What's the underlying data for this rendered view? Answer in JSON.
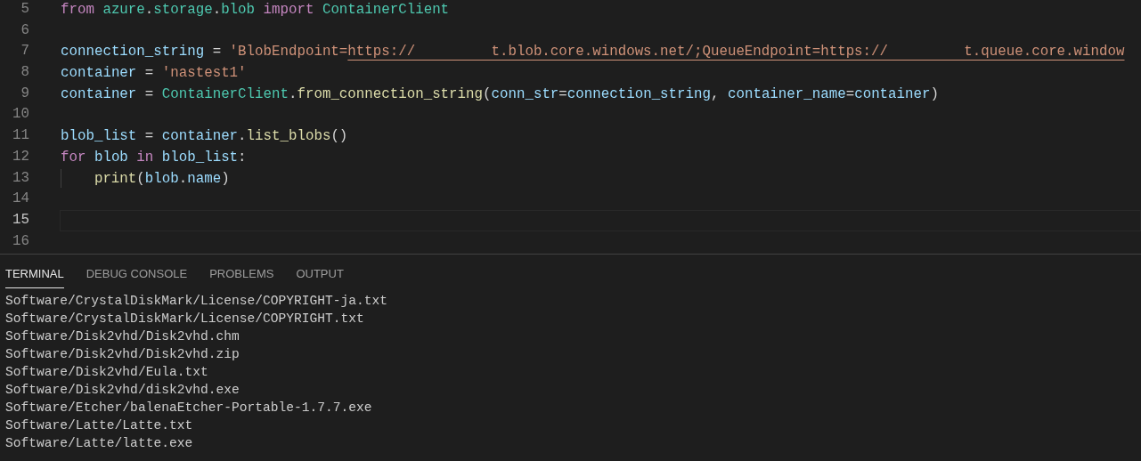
{
  "editor": {
    "lines": [
      {
        "number": "5",
        "current": false,
        "indented": false,
        "tokens": [
          {
            "text": "from ",
            "kind": "keyword"
          },
          {
            "text": "azure",
            "kind": "namespace"
          },
          {
            "text": ".",
            "kind": "plain"
          },
          {
            "text": "storage",
            "kind": "namespace"
          },
          {
            "text": ".",
            "kind": "plain"
          },
          {
            "text": "blob ",
            "kind": "namespace"
          },
          {
            "text": "import ",
            "kind": "keyword"
          },
          {
            "text": "ContainerClient",
            "kind": "namespace"
          }
        ]
      },
      {
        "number": "6",
        "current": false,
        "indented": false
      },
      {
        "number": "7",
        "current": false,
        "indented": false,
        "tokens": [
          {
            "text": "connection_string",
            "kind": "variable"
          },
          {
            "text": " = ",
            "kind": "plain"
          },
          {
            "text": "'BlobEndpoint=",
            "kind": "string"
          },
          {
            "text": "https://         t.blob.core.windows.net/;QueueEndpoint=https://         t.queue.core.window",
            "kind": "link"
          }
        ]
      },
      {
        "number": "8",
        "current": false,
        "indented": false,
        "tokens": [
          {
            "text": "container",
            "kind": "variable"
          },
          {
            "text": " = ",
            "kind": "plain"
          },
          {
            "text": "'nastest1'",
            "kind": "string"
          }
        ]
      },
      {
        "number": "9",
        "current": false,
        "indented": false,
        "tokens": [
          {
            "text": "container",
            "kind": "variable"
          },
          {
            "text": " = ",
            "kind": "plain"
          },
          {
            "text": "ContainerClient",
            "kind": "namespace"
          },
          {
            "text": ".",
            "kind": "plain"
          },
          {
            "text": "from_connection_string",
            "kind": "function"
          },
          {
            "text": "(",
            "kind": "plain"
          },
          {
            "text": "conn_str",
            "kind": "variable"
          },
          {
            "text": "=",
            "kind": "plain"
          },
          {
            "text": "connection_string",
            "kind": "variable"
          },
          {
            "text": ", ",
            "kind": "plain"
          },
          {
            "text": "container_name",
            "kind": "variable"
          },
          {
            "text": "=",
            "kind": "plain"
          },
          {
            "text": "container",
            "kind": "variable"
          },
          {
            "text": ")",
            "kind": "plain"
          }
        ]
      },
      {
        "number": "10",
        "current": false,
        "indented": false
      },
      {
        "number": "11",
        "current": false,
        "indented": false,
        "tokens": [
          {
            "text": "blob_list",
            "kind": "variable"
          },
          {
            "text": " = ",
            "kind": "plain"
          },
          {
            "text": "container",
            "kind": "variable"
          },
          {
            "text": ".",
            "kind": "plain"
          },
          {
            "text": "list_blobs",
            "kind": "function"
          },
          {
            "text": "()",
            "kind": "plain"
          }
        ]
      },
      {
        "number": "12",
        "current": false,
        "indented": false,
        "tokens": [
          {
            "text": "for ",
            "kind": "keyword"
          },
          {
            "text": "blob ",
            "kind": "variable"
          },
          {
            "text": "in ",
            "kind": "keyword"
          },
          {
            "text": "blob_list",
            "kind": "variable"
          },
          {
            "text": ":",
            "kind": "plain"
          }
        ]
      },
      {
        "number": "13",
        "current": false,
        "indented": true,
        "tokens": [
          {
            "text": "print",
            "kind": "function"
          },
          {
            "text": "(",
            "kind": "plain"
          },
          {
            "text": "blob",
            "kind": "variable"
          },
          {
            "text": ".",
            "kind": "plain"
          },
          {
            "text": "name",
            "kind": "variable"
          },
          {
            "text": ")",
            "kind": "plain"
          }
        ]
      },
      {
        "number": "14",
        "current": false,
        "indented": false
      },
      {
        "number": "15",
        "current": true,
        "indented": false
      },
      {
        "number": "16",
        "current": false,
        "indented": false
      }
    ]
  },
  "panel": {
    "tabs": [
      {
        "label": "TERMINAL",
        "selected": true
      },
      {
        "label": "DEBUG CONSOLE",
        "selected": false
      },
      {
        "label": "PROBLEMS",
        "selected": false
      },
      {
        "label": "OUTPUT",
        "selected": false
      }
    ],
    "terminal_lines": [
      "Software/CrystalDiskMark/License/COPYRIGHT-ja.txt",
      "Software/CrystalDiskMark/License/COPYRIGHT.txt",
      "Software/Disk2vhd/Disk2vhd.chm",
      "Software/Disk2vhd/Disk2vhd.zip",
      "Software/Disk2vhd/Eula.txt",
      "Software/Disk2vhd/disk2vhd.exe",
      "Software/Etcher/balenaEtcher-Portable-1.7.7.exe",
      "Software/Latte/Latte.txt",
      "Software/Latte/latte.exe"
    ]
  }
}
